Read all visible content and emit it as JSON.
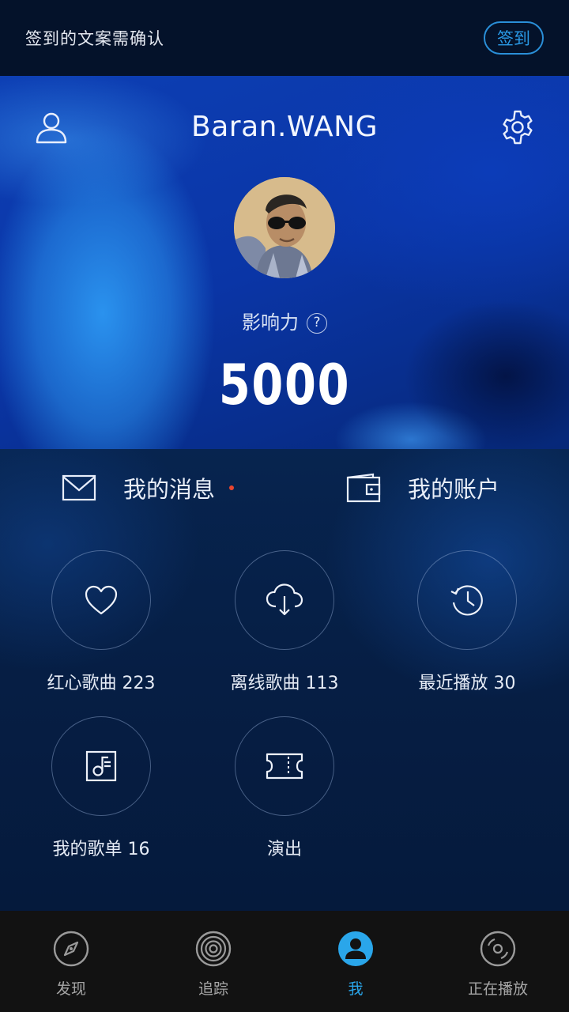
{
  "topbar": {
    "notice": "签到的文案需确认",
    "checkin_label": "签到"
  },
  "profile": {
    "username": "Baran.WANG",
    "influence_label": "影响力",
    "help_glyph": "?",
    "influence_score": "5000"
  },
  "links": {
    "messages": "我的消息",
    "account": "我的账户"
  },
  "tiles": [
    {
      "label": "红心歌曲 223",
      "icon": "heart-icon"
    },
    {
      "label": "离线歌曲 113",
      "icon": "cloud-download-icon"
    },
    {
      "label": "最近播放 30",
      "icon": "history-icon"
    },
    {
      "label": "我的歌单 16",
      "icon": "playlist-icon"
    },
    {
      "label": "演出",
      "icon": "ticket-icon"
    }
  ],
  "tabs": [
    {
      "label": "发现",
      "icon": "compass-icon"
    },
    {
      "label": "追踪",
      "icon": "radar-icon"
    },
    {
      "label": "我",
      "icon": "profile-icon",
      "active": true
    },
    {
      "label": "正在播放",
      "icon": "vinyl-icon"
    }
  ],
  "colors": {
    "accent": "#2aa6ea",
    "notification_dot": "#e8452f",
    "tab_bg": "#121212"
  }
}
